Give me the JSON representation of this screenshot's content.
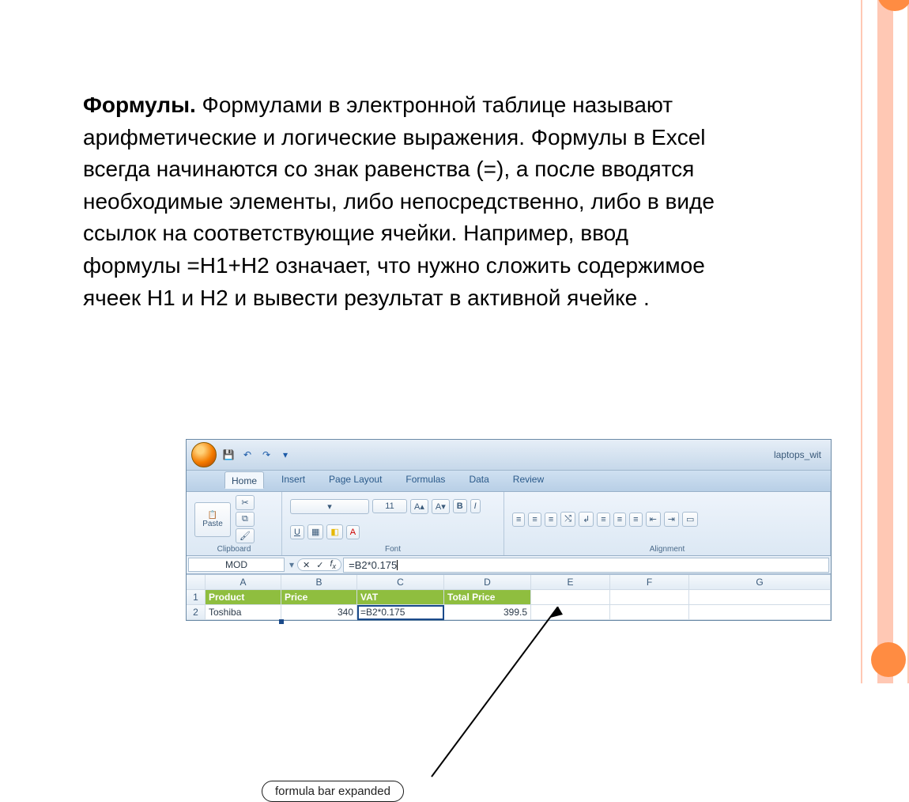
{
  "text": {
    "title_word": "Формулы.",
    "body": " Формулами в электронной таблице называют арифметические и логические выражения. Формулы в Excel всегда начинаются со знак равенства (=), а после вводятся необходимые элементы, либо непосредственно, либо в виде ссылок на соответствующие ячейки. Например, ввод формулы =H1+H2 означает, что нужно сложить содержимое ячеек H1 и H2 и вывести результат в активной ячейке ."
  },
  "excel": {
    "doc_title": "laptops_wit",
    "tabs": [
      "Home",
      "Insert",
      "Page Layout",
      "Formulas",
      "Data",
      "Review"
    ],
    "active_tab": "Home",
    "groups": {
      "clipboard": "Clipboard",
      "font": "Font",
      "alignment": "Alignment",
      "paste": "Paste",
      "font_size": "11"
    },
    "namebox": "MOD",
    "formula": "=B2*0.175",
    "columns": [
      "",
      "A",
      "B",
      "C",
      "D",
      "E",
      "F",
      "G"
    ],
    "rows": [
      {
        "n": "1",
        "cells": [
          "Product",
          "Price",
          "VAT",
          "Total Price",
          "",
          "",
          ""
        ],
        "header": true
      },
      {
        "n": "2",
        "cells": [
          "Toshiba",
          "340",
          "=B2*0.175",
          "399.5",
          "",
          "",
          ""
        ],
        "header": false
      }
    ],
    "callout": "formula bar expanded"
  }
}
